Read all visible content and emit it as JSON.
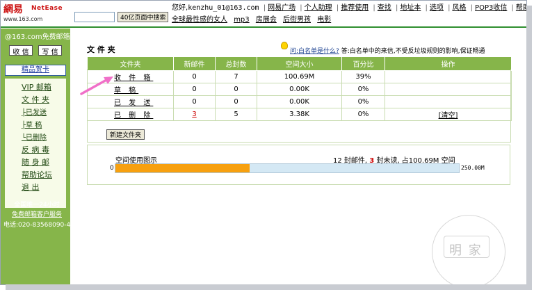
{
  "header": {
    "logo_cn": "網易",
    "logo_en": "NetEase",
    "logo_url": "www.163.com",
    "greeting": "您好,",
    "user": "kenzhu_01@163.com",
    "nav": [
      "网易广场",
      "个人助理",
      "推荐使用",
      "查找",
      "地址本",
      "选项",
      "风格",
      "POP3收信",
      "帮助",
      "退出"
    ],
    "search_placeholder": "",
    "search_button": "40亿页面中搜索",
    "hotlinks": [
      "全球最性感的女人",
      "mp3",
      "房展会",
      "后街男孩",
      "电影"
    ]
  },
  "sidebar": {
    "title": "@163.com免费邮箱",
    "inbox_btn": "收 信",
    "compose_btn": "写 信",
    "cards": "精品贺卡",
    "menu": [
      {
        "label": "VIP 邮箱",
        "indent": false
      },
      {
        "label": "文 件 夹",
        "indent": false
      },
      {
        "label": "├已发送",
        "indent": true
      },
      {
        "label": "├草 稿",
        "indent": true
      },
      {
        "label": "└已删除",
        "indent": true
      },
      {
        "label": "反 病 毒",
        "indent": false
      },
      {
        "label": "随 身 邮",
        "indent": false
      },
      {
        "label": "帮助论坛",
        "indent": false
      },
      {
        "label": "退 出",
        "indent": false
      }
    ],
    "service_1": "全国唯一24小时",
    "service_2": "免费邮箱客户服务",
    "service_phone": "电话:020-83568090-4"
  },
  "main": {
    "title": "文 件 夹",
    "help_q": "问:白名单是什么?",
    "help_a": "答:白名单中的来信,不受反垃圾规则的影响,保证畅通",
    "columns": [
      "文件夹",
      "新邮件",
      "总封数",
      "空间大小",
      "百分比",
      "操作"
    ],
    "rows": [
      {
        "name": "收 件 箱",
        "new": "0",
        "total": "7",
        "size": "100.69M",
        "pct": "39%",
        "action": ""
      },
      {
        "name": "草 稿",
        "new": "0",
        "total": "0",
        "size": "0.00K",
        "pct": "0%",
        "action": ""
      },
      {
        "name": "已 发 送",
        "new": "0",
        "total": "0",
        "size": "0.00K",
        "pct": "0%",
        "action": ""
      },
      {
        "name": "已 删 除",
        "new": "3",
        "total": "5",
        "size": "3.38K",
        "pct": "0%",
        "action": "[清空]"
      }
    ],
    "new_folder_btn": "新建文件夹",
    "usage_title": "空间使用图示",
    "usage_total": "12",
    "usage_text1": "封邮件,",
    "usage_unread": "3",
    "usage_text2": "封未读, 占100.69M 空间",
    "bar_min": "0",
    "bar_max": "250.00M",
    "usage_fraction": 0.39
  },
  "watermark": "明 家",
  "colors": {
    "sidebar": "#86b54a",
    "header_rule": "#2f8f2f",
    "bar_fill": "#f7a00f",
    "bar_track": "#d4e8f4",
    "accent_red": "#cc0000"
  }
}
